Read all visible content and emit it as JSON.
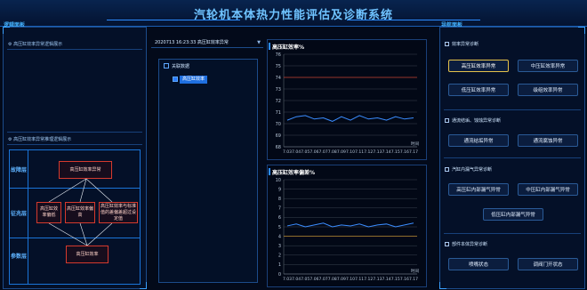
{
  "header": {
    "title": "汽轮机本体热力性能评估及诊断系统",
    "left_panel_label": "逻辑面板",
    "right_panel_label": "导航面板"
  },
  "left": {
    "section1": "高压缸效率异常逻辑展示",
    "section2": "高压缸效率异常推理逻辑展示",
    "layers": [
      "故障层",
      "征兆层",
      "参数层"
    ],
    "nodes": {
      "fault": "高压缸效率异常",
      "symptom1": "高压缸效率偏低",
      "symptom2": "高压缸效率偏高",
      "symptom3": "高压缸效率与标准值的差偏差超过设定值",
      "param": "高压缸效率"
    }
  },
  "middle": {
    "time_range": "2020713 16:23:33 高压缸效率异常",
    "related_title": "关联数据",
    "related_items": [
      "高压缸效率"
    ]
  },
  "charts": {
    "chart1": {
      "title": "高压缸效率%",
      "unit_label": "时间"
    },
    "chart2": {
      "title": "高压缸效率偏差%",
      "unit_label": "时间"
    }
  },
  "chart_data": [
    {
      "type": "line",
      "title": "高压缸效率%",
      "x": [
        "7.03",
        "7.04",
        "7.05",
        "7.06",
        "7.07",
        "7.08",
        "7.09",
        "7.10",
        "7.11",
        "7.12",
        "7.13",
        "7.14",
        "7.15",
        "7.16",
        "7.17"
      ],
      "yticks": [
        "76",
        "75",
        "74",
        "73",
        "72",
        "71",
        "70",
        "69",
        "68"
      ],
      "ylim": [
        68,
        76
      ],
      "series": [
        {
          "color": "#3b8dff",
          "values": [
            70.3,
            70.6,
            70.7,
            70.4,
            70.5,
            70.2,
            70.6,
            70.3,
            70.7,
            70.4,
            70.5,
            70.3,
            70.6,
            70.4,
            70.5
          ]
        }
      ],
      "reference_lines": [
        {
          "value": 74,
          "color": "#c0392b"
        }
      ]
    },
    {
      "type": "line",
      "title": "高压缸效率偏差%",
      "x": [
        "7.03",
        "7.04",
        "7.05",
        "7.06",
        "7.07",
        "7.08",
        "7.09",
        "7.10",
        "7.11",
        "7.12",
        "7.13",
        "7.14",
        "7.15",
        "7.16",
        "7.17"
      ],
      "yticks": [
        "10",
        "9",
        "8",
        "7",
        "6",
        "5",
        "4",
        "3",
        "2",
        "1",
        "0"
      ],
      "ylim": [
        0,
        10
      ],
      "series": [
        {
          "color": "#3b8dff",
          "values": [
            5.1,
            5.3,
            5.0,
            5.2,
            5.4,
            5.0,
            5.2,
            5.1,
            5.3,
            5.0,
            5.2,
            5.3,
            5.0,
            5.2,
            5.4
          ]
        }
      ],
      "reference_lines": [
        {
          "value": 4,
          "color": "#b98a2e"
        }
      ]
    }
  ],
  "right": {
    "sections": [
      {
        "title": "效率异常诊断",
        "buttons": [
          "高压缸效率异常",
          "中压缸效率异常",
          "低压缸效率异常",
          "级组效率异常"
        ]
      },
      {
        "title": "通流结垢、蚀蚀异常诊断",
        "buttons": [
          "通流结垢异常",
          "通流腐蚀异常"
        ]
      },
      {
        "title": "汽缸内漏气异常诊断",
        "buttons": [
          "高压缸内部漏气异常",
          "中压缸内部漏气异常",
          "低压缸内部漏气异常"
        ]
      },
      {
        "title": "部件本体异常诊断",
        "buttons": [
          "喷嘴状态",
          "调阀门开状态"
        ]
      }
    ],
    "active_button": "高压缸效率异常",
    "accent": "#e4c24a"
  }
}
